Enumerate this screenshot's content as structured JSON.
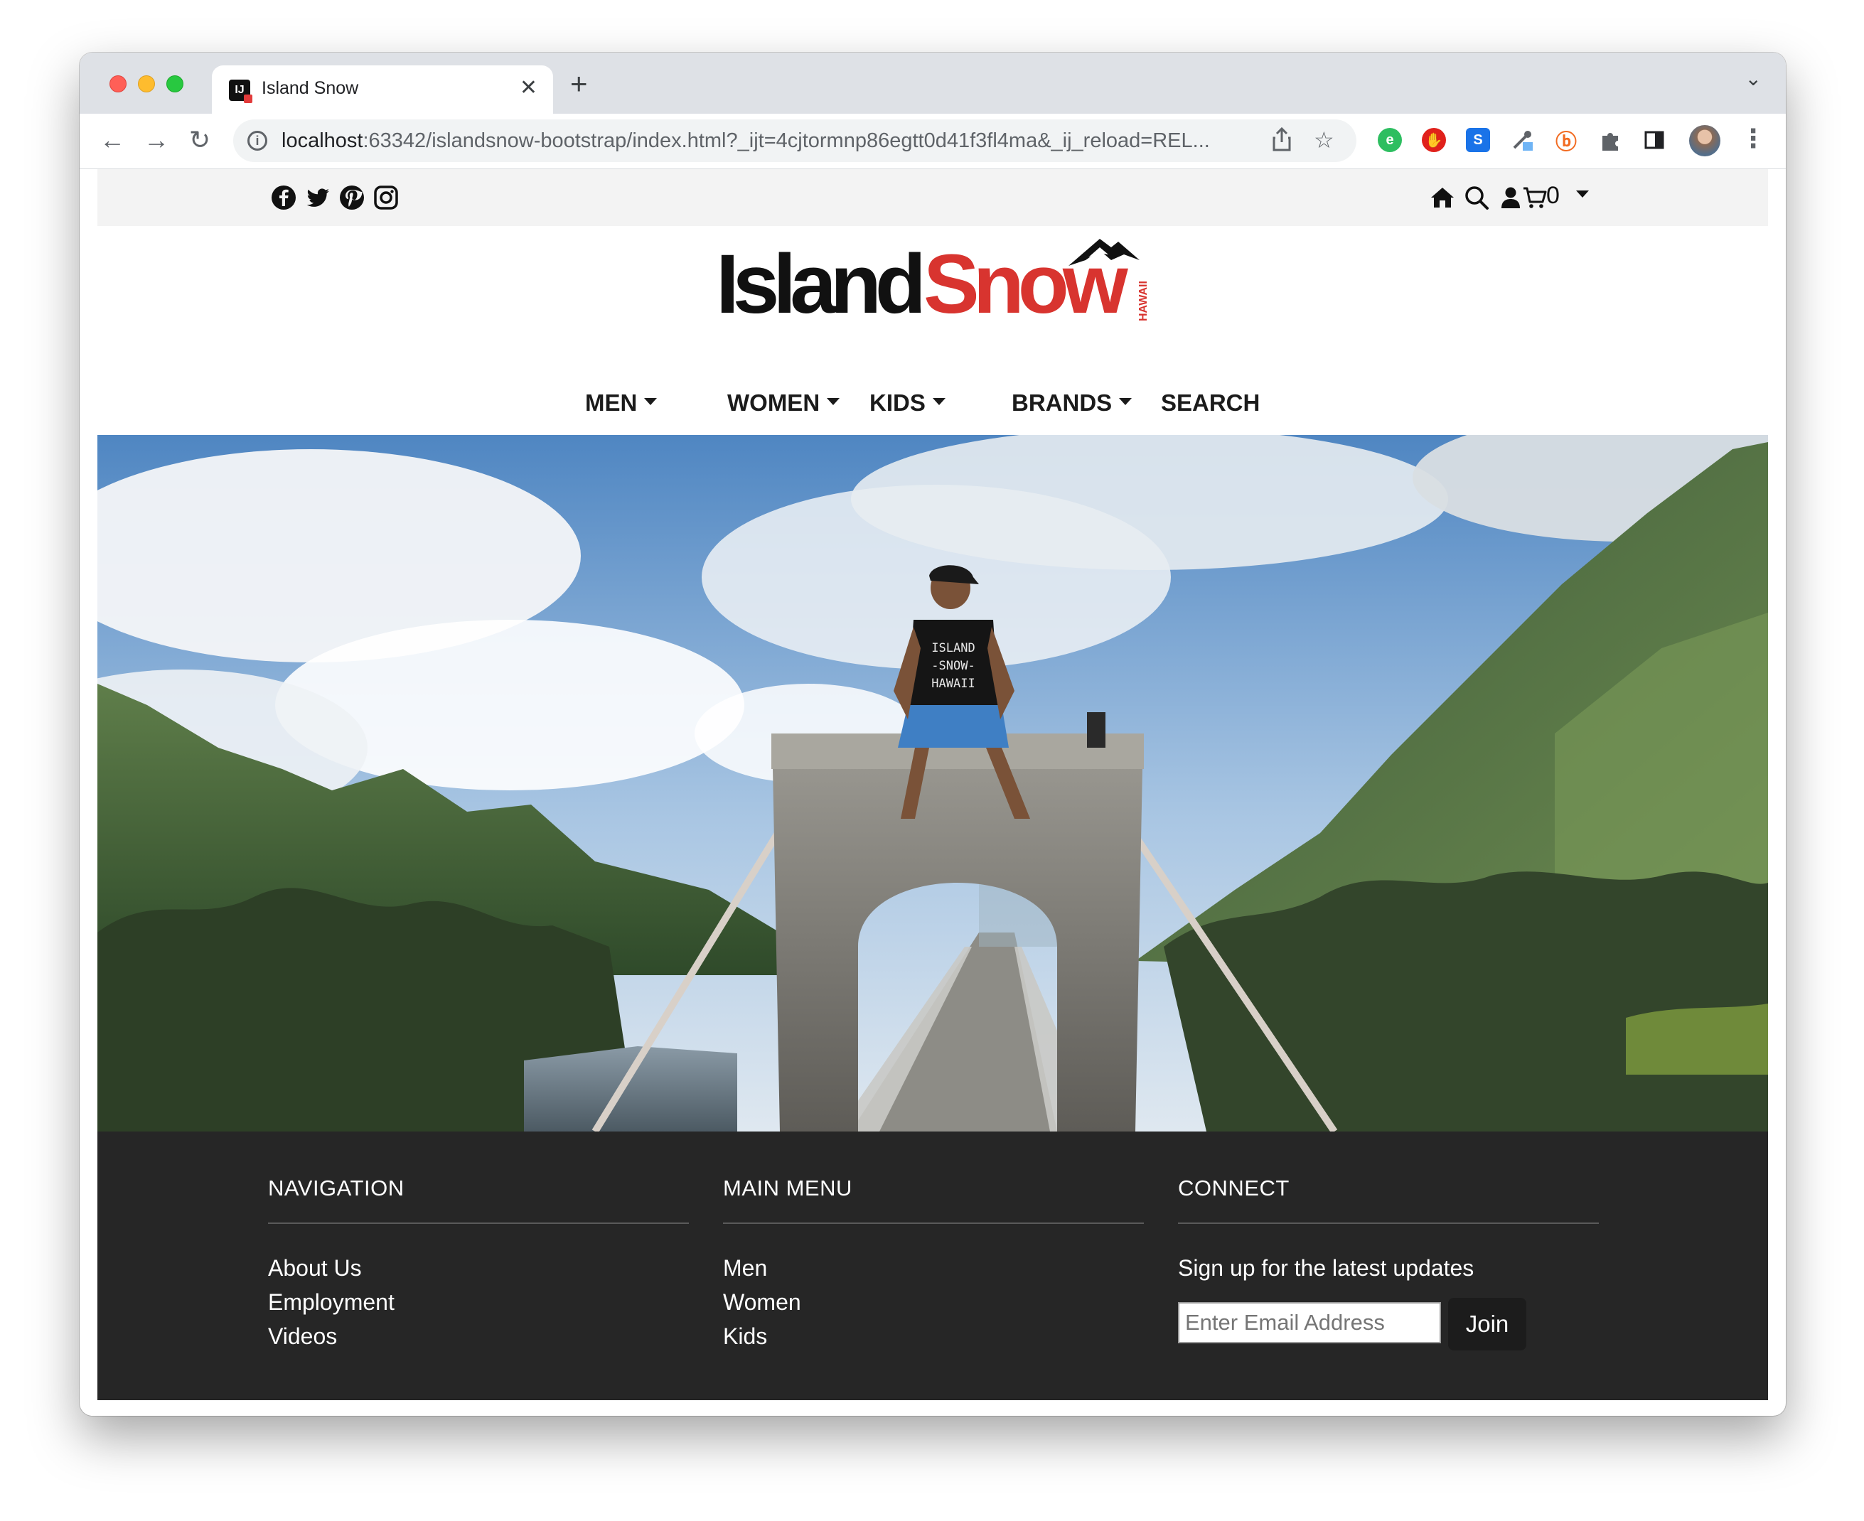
{
  "browser": {
    "tab_title": "Island Snow",
    "favicon_text": "IJ",
    "url_host": "localhost",
    "url_rest": ":63342/islandsnow-bootstrap/index.html?_ijt=4cjtormnp86egtt0d41f3fl4ma&_ij_reload=REL..."
  },
  "topbar": {
    "social_icons": [
      "facebook-icon",
      "twitter-icon",
      "pinterest-icon",
      "instagram-icon"
    ],
    "right_icons": [
      "home-icon",
      "search-icon",
      "user-icon",
      "cart-icon"
    ],
    "cart_count": "0"
  },
  "logo": {
    "word1": "Island",
    "word2": "Snow",
    "tagline": "HAWAII",
    "color1": "#111111",
    "color2": "#d8342f"
  },
  "nav": {
    "men": "MEN",
    "women": "WOMEN",
    "kids": "KIDS",
    "brands": "BRANDS",
    "search": "SEARCH"
  },
  "hero": {
    "shirt_line1": "ISLAND",
    "shirt_line2": "-SNOW-",
    "shirt_line3": "HAWAII"
  },
  "footer": {
    "navigation": {
      "heading": "NAVIGATION",
      "links": [
        "About Us",
        "Employment",
        "Videos"
      ]
    },
    "main_menu": {
      "heading": "MAIN MENU",
      "links": [
        "Men",
        "Women",
        "Kids"
      ]
    },
    "connect": {
      "heading": "CONNECT",
      "signup_text": "Sign up for the latest updates",
      "email_placeholder": "Enter Email Address",
      "join_label": "Join"
    }
  },
  "colors": {
    "footer_bg": "#262626",
    "topbar_bg": "#f3f3f3",
    "brand_red": "#d8342f"
  }
}
